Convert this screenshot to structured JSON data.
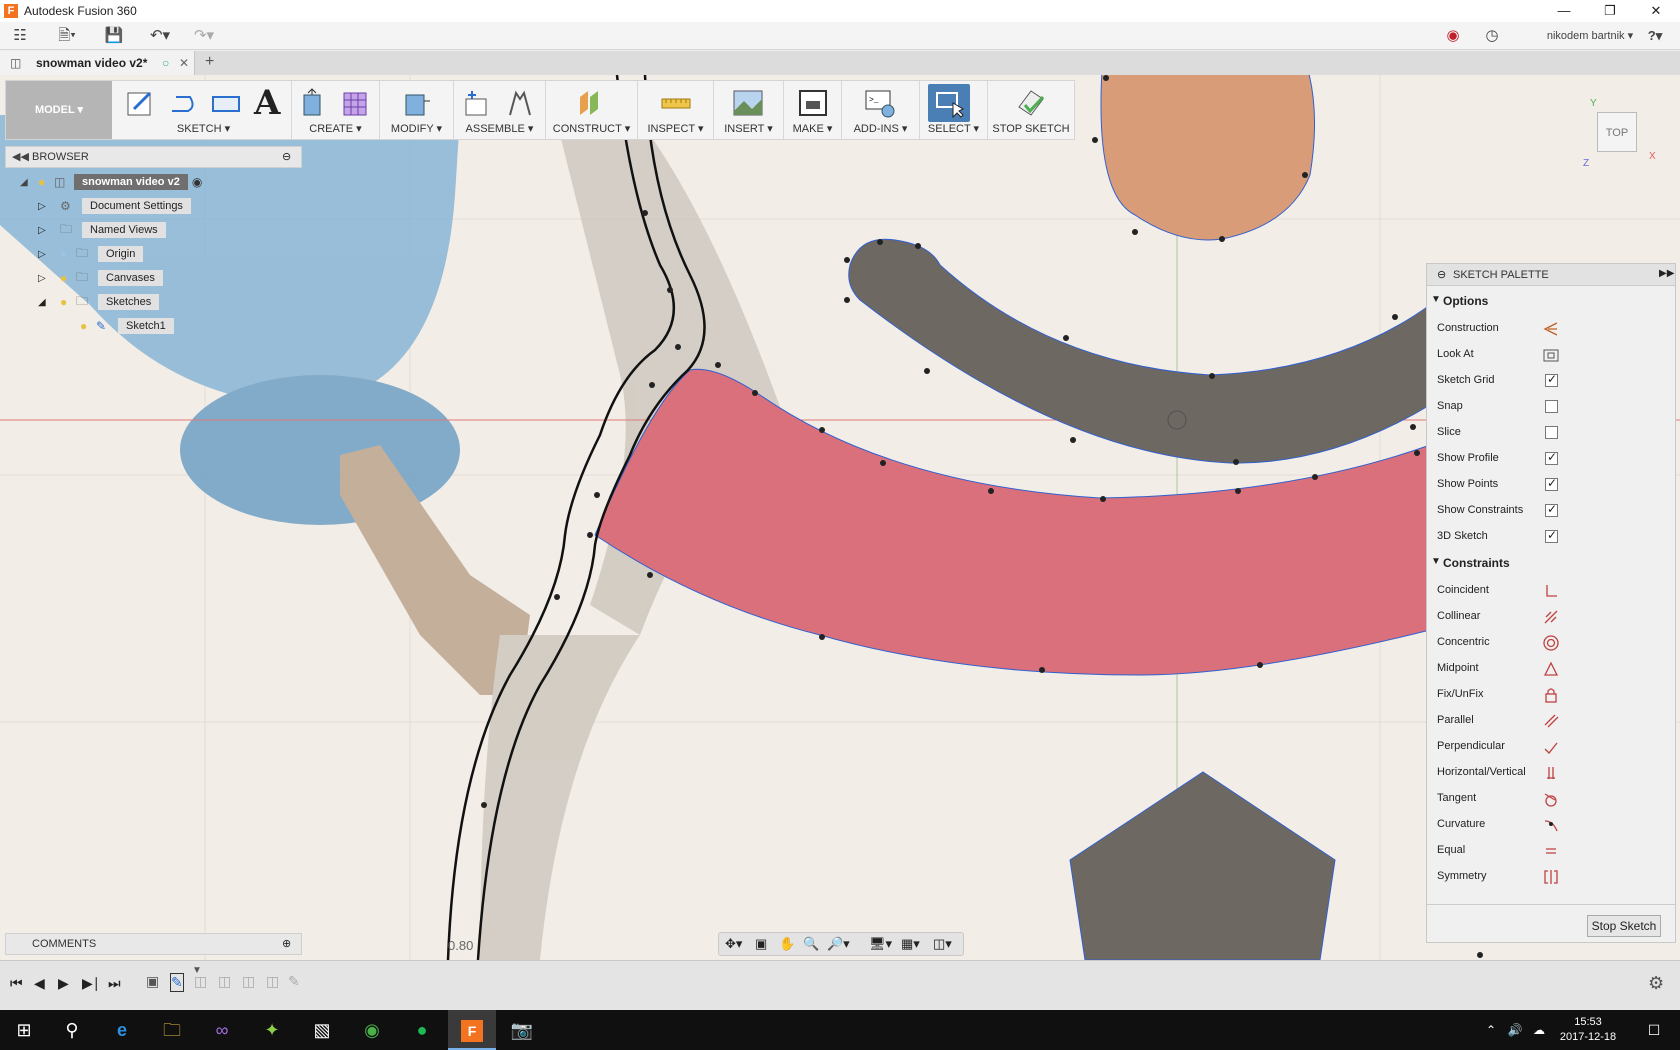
{
  "window": {
    "title": "Autodesk Fusion 360",
    "app_icon": "F"
  },
  "qat": {
    "user": "nikodem bartnik",
    "help": "?"
  },
  "doc_tab": {
    "label": "snowman video v2*"
  },
  "toolbar": {
    "workspace": "MODEL",
    "groups": {
      "sketch": "SKETCH",
      "create": "CREATE",
      "modify": "MODIFY",
      "assemble": "ASSEMBLE",
      "construct": "CONSTRUCT",
      "inspect": "INSPECT",
      "insert": "INSERT",
      "make": "MAKE",
      "addins": "ADD-INS",
      "select": "SELECT",
      "stop_sketch": "STOP SKETCH"
    }
  },
  "browser": {
    "title": "BROWSER",
    "root": "snowman video v2",
    "items": [
      "Document Settings",
      "Named Views",
      "Origin",
      "Canvases",
      "Sketches"
    ],
    "sketch": "Sketch1"
  },
  "comments": {
    "title": "COMMENTS"
  },
  "viewcube": {
    "face": "TOP",
    "axis_x": "X",
    "axis_y": "Y",
    "axis_z": "Z"
  },
  "palette": {
    "title": "SKETCH PALETTE",
    "options_header": "Options",
    "options": [
      {
        "label": "Construction",
        "icon": "construction-icon"
      },
      {
        "label": "Look At",
        "icon": "look-at-icon"
      },
      {
        "label": "Sketch Grid",
        "checked": true
      },
      {
        "label": "Snap",
        "checked": false
      },
      {
        "label": "Slice",
        "checked": false
      },
      {
        "label": "Show Profile",
        "checked": true
      },
      {
        "label": "Show Points",
        "checked": true
      },
      {
        "label": "Show Constraints",
        "checked": true
      },
      {
        "label": "3D Sketch",
        "checked": true
      }
    ],
    "constraints_header": "Constraints",
    "constraints": [
      {
        "label": "Coincident",
        "icon": "coincident-icon"
      },
      {
        "label": "Collinear",
        "icon": "collinear-icon"
      },
      {
        "label": "Concentric",
        "icon": "concentric-icon"
      },
      {
        "label": "Midpoint",
        "icon": "midpoint-icon"
      },
      {
        "label": "Fix/UnFix",
        "icon": "lock-icon"
      },
      {
        "label": "Parallel",
        "icon": "parallel-icon"
      },
      {
        "label": "Perpendicular",
        "icon": "perpendicular-icon"
      },
      {
        "label": "Horizontal/Vertical",
        "icon": "horizontal-vertical-icon"
      },
      {
        "label": "Tangent",
        "icon": "tangent-icon"
      },
      {
        "label": "Curvature",
        "icon": "curvature-icon"
      },
      {
        "label": "Equal",
        "icon": "equal-icon"
      },
      {
        "label": "Symmetry",
        "icon": "symmetry-icon"
      }
    ],
    "stop_button": "Stop Sketch"
  },
  "viewport": {
    "dimension_text": "0.80"
  },
  "taskbar": {
    "time": "15:53",
    "date": "2017-12-18"
  },
  "colors": {
    "accent": "#4a7fb5",
    "profile_red": "#d9707c",
    "profile_dark": "#6e6863",
    "orange": "#d99c78"
  }
}
